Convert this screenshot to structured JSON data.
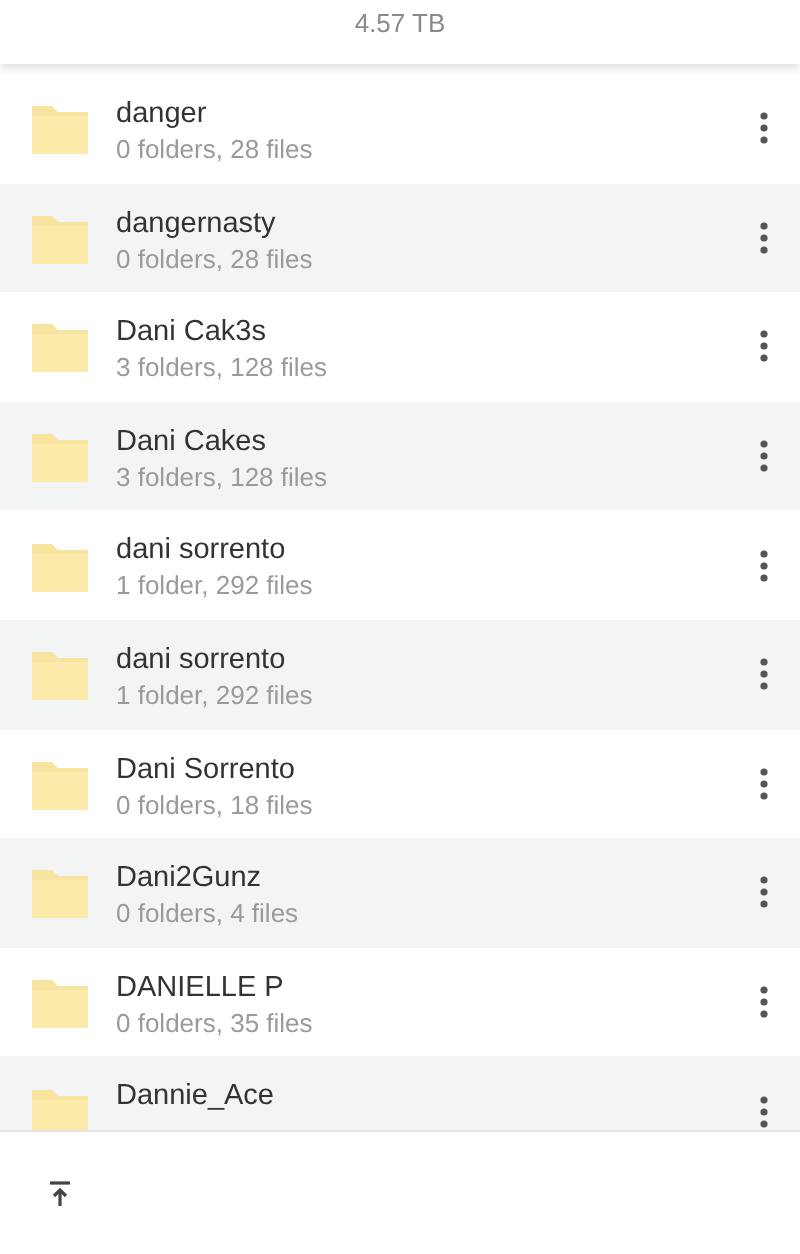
{
  "header": {
    "capacity": "4.57 TB"
  },
  "folders": [
    {
      "name": "danger",
      "details": "0 folders, 28 files"
    },
    {
      "name": "dangernasty",
      "details": "0 folders, 28 files"
    },
    {
      "name": "Dani Cak3s",
      "details": "3 folders, 128 files"
    },
    {
      "name": "Dani Cakes",
      "details": "3 folders, 128 files"
    },
    {
      "name": "dani sorrento",
      "details": "1 folder, 292 files"
    },
    {
      "name": "dani sorrento",
      "details": "1 folder, 292 files"
    },
    {
      "name": "Dani Sorrento",
      "details": "0 folders, 18 files"
    },
    {
      "name": "Dani2Gunz",
      "details": "0 folders, 4 files"
    },
    {
      "name": "DANIELLE P",
      "details": "0 folders, 35 files"
    },
    {
      "name": "Dannie_Ace"
    }
  ]
}
